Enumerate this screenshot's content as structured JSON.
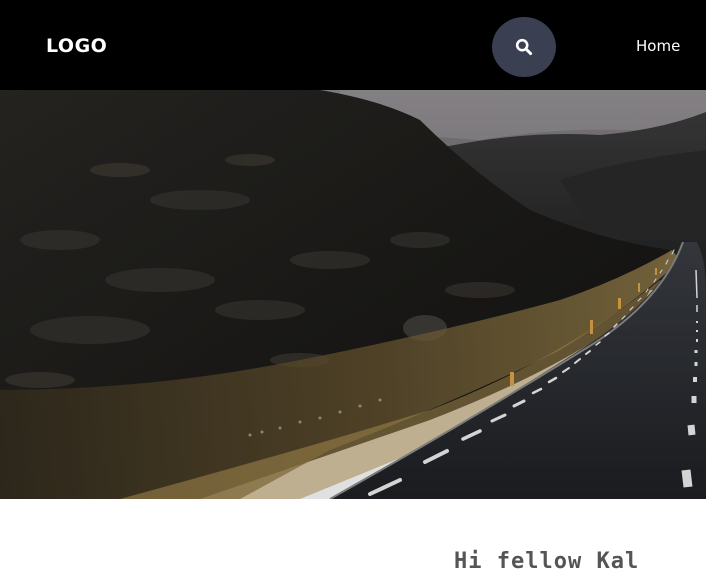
{
  "header": {
    "logo_text": "LOGO",
    "search_icon": "search-icon",
    "nav": [
      {
        "label": "Home"
      }
    ]
  },
  "hero": {
    "image": "mountain-road-photo"
  },
  "content": {
    "heading_partial": "Hi fellow Kal"
  },
  "colors": {
    "header_bg": "#000000",
    "search_button_bg": "#3b3f52",
    "page_bg": "#ffffff"
  }
}
